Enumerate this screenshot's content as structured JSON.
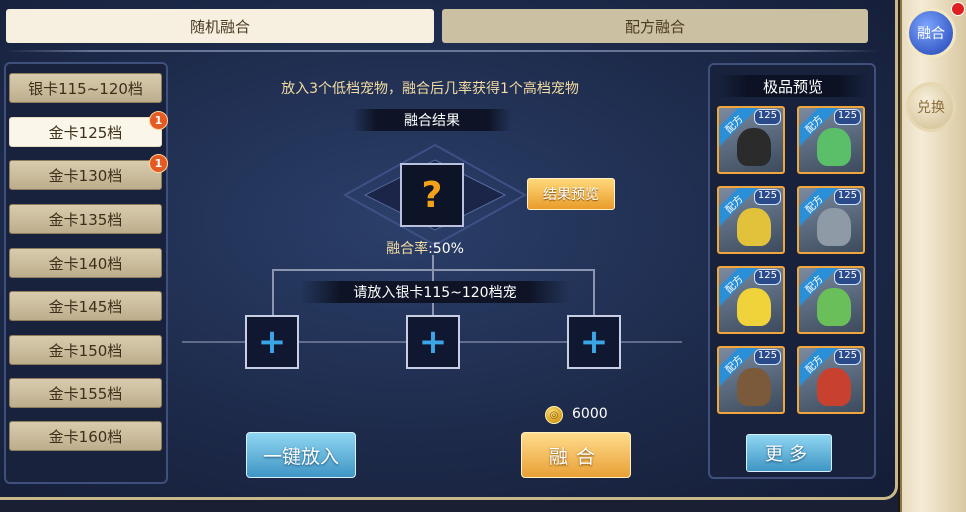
{
  "tabs": [
    {
      "label": "随机融合",
      "active": true
    },
    {
      "label": "配方融合",
      "active": false
    }
  ],
  "side_buttons": [
    {
      "label": "融合",
      "active": true
    },
    {
      "label": "兑换",
      "active": false
    }
  ],
  "tiers": [
    {
      "label": "银卡115~120档",
      "selected": false,
      "badge": ""
    },
    {
      "label": "金卡125档",
      "selected": true,
      "badge": "1"
    },
    {
      "label": "金卡130档",
      "selected": false,
      "badge": "1"
    },
    {
      "label": "金卡135档",
      "selected": false,
      "badge": ""
    },
    {
      "label": "金卡140档",
      "selected": false,
      "badge": ""
    },
    {
      "label": "金卡145档",
      "selected": false,
      "badge": ""
    },
    {
      "label": "金卡150档",
      "selected": false,
      "badge": ""
    },
    {
      "label": "金卡155档",
      "selected": false,
      "badge": ""
    },
    {
      "label": "金卡160档",
      "selected": false,
      "badge": ""
    }
  ],
  "fusion": {
    "info": "放入3个低档宠物，融合后几率获得1个高档宠物",
    "result_title": "融合结果",
    "result_placeholder": "?",
    "preview_button": "结果预览",
    "rate_label": "融合率",
    "rate_value": ":50%",
    "slots_title": "请放入银卡115~120档宠",
    "slot_symbol": "+",
    "fill_button": "一键放入",
    "fuse_button": "融合",
    "cost": "6000"
  },
  "preview": {
    "title": "极品预览",
    "more_button": "更多",
    "card_ribbon": "配方",
    "cards": [
      {
        "level": "125",
        "color": "#2b2b2b"
      },
      {
        "level": "125",
        "color": "#5bbf6a"
      },
      {
        "level": "125",
        "color": "#e2c23a"
      },
      {
        "level": "125",
        "color": "#8e9aa6"
      },
      {
        "level": "125",
        "color": "#f0d23a"
      },
      {
        "level": "125",
        "color": "#6bbf5a"
      },
      {
        "level": "125",
        "color": "#7a5a3a"
      },
      {
        "level": "125",
        "color": "#c8402e"
      }
    ]
  }
}
